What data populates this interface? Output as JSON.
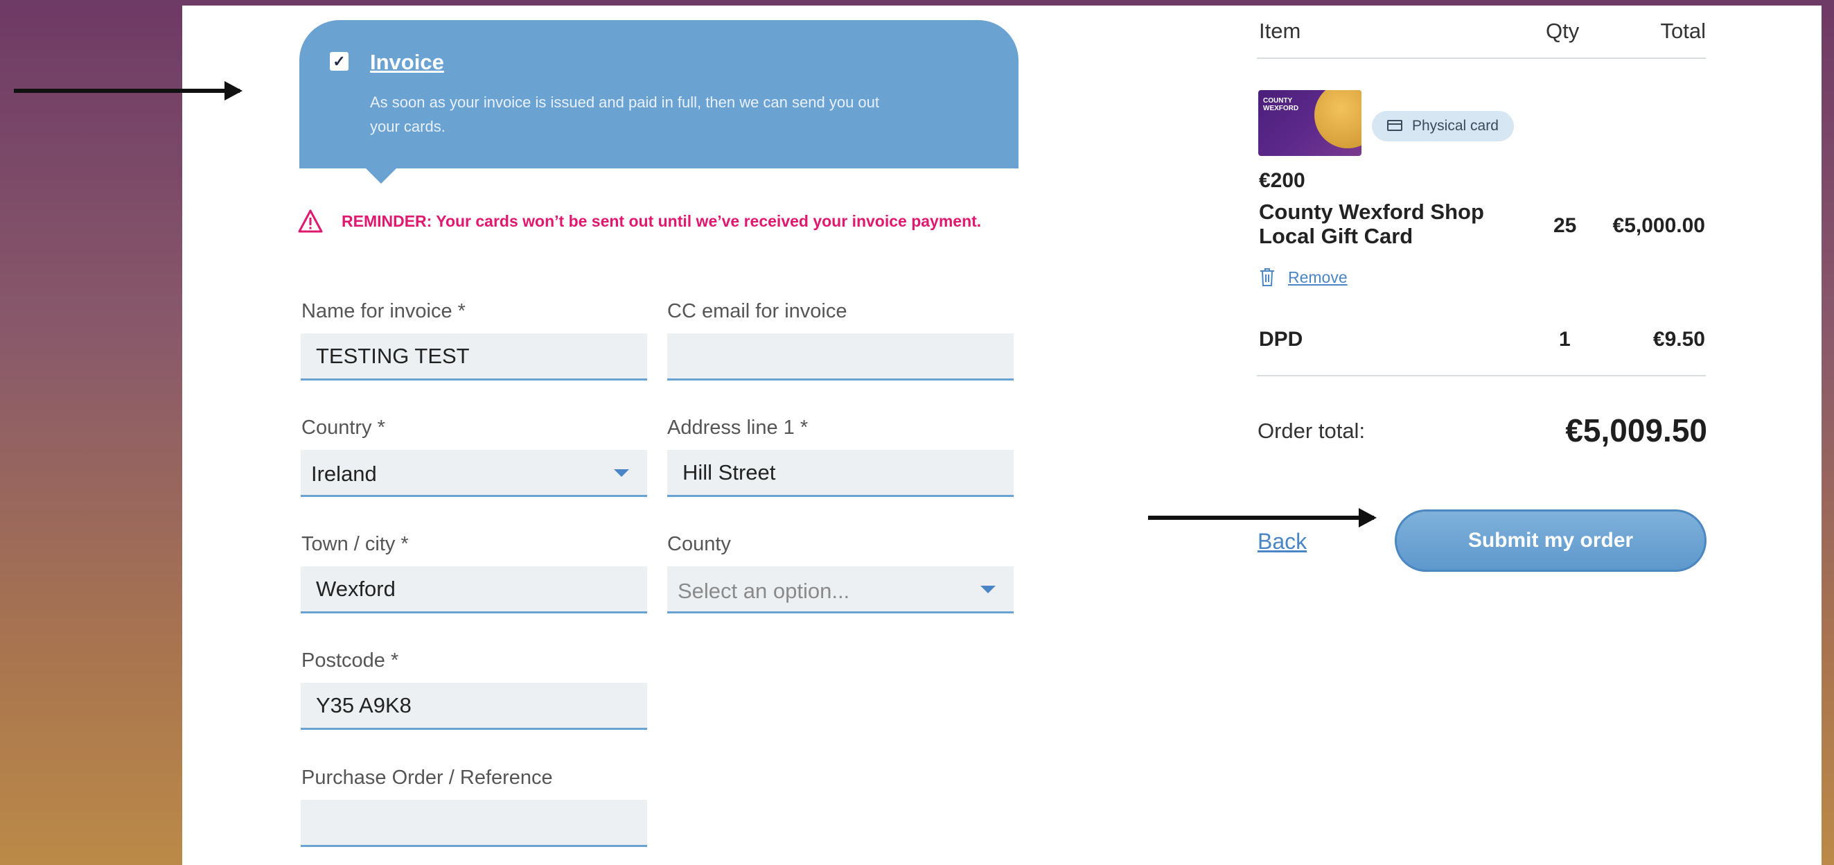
{
  "invoice": {
    "checked": true,
    "title": "Invoice",
    "description": "As soon as your invoice is issued and paid in full, then we can send you out your cards."
  },
  "reminder": "REMINDER: Your cards won’t be sent out until we’ve received your invoice payment.",
  "form": {
    "name_label": "Name for invoice *",
    "name_value": "TESTING TEST",
    "cc_label": "CC email for invoice",
    "cc_value": "",
    "country_label": "Country *",
    "country_value": "Ireland",
    "address_label": "Address line 1 *",
    "address_value": "Hill Street",
    "town_label": "Town / city *",
    "town_value": "Wexford",
    "county_label": "County",
    "county_placeholder": "Select an option...",
    "postcode_label": "Postcode *",
    "postcode_value": "Y35 A9K8",
    "po_label": "Purchase Order / Reference",
    "po_value": ""
  },
  "summary": {
    "headers": {
      "item": "Item",
      "qty": "Qty",
      "total": "Total"
    },
    "product": {
      "card_text": "COUNTY WEXFORD",
      "badge": "Physical card",
      "denomination": "€200",
      "name": "County Wexford Shop Local Gift Card",
      "qty": "25",
      "total": "€5,000.00",
      "remove_label": "Remove"
    },
    "shipping": {
      "name": "DPD",
      "qty": "1",
      "total": "€9.50"
    },
    "order_total_label": "Order total:",
    "order_total_value": "€5,009.50",
    "back_label": "Back",
    "submit_label": "Submit my order"
  },
  "colors": {
    "accent": "#6aa2d2",
    "reminder": "#e0186f",
    "link": "#4a86c5"
  }
}
